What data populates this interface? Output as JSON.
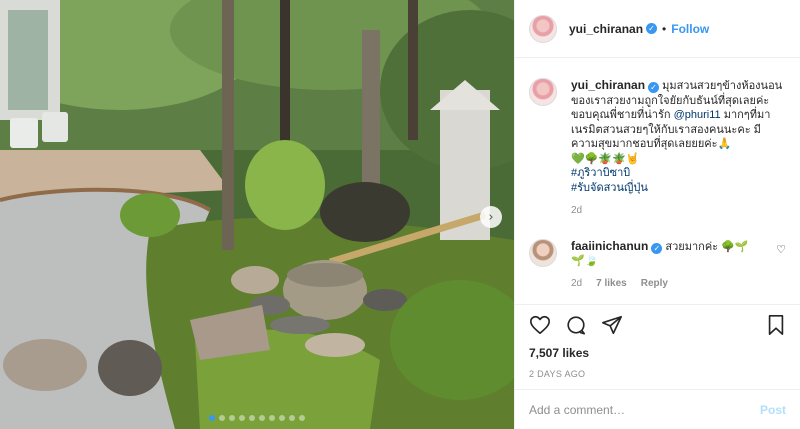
{
  "post": {
    "username": "yui_chiranan",
    "verified_mark": "✓",
    "separator": "•",
    "follow_label": "Follow",
    "carousel": {
      "dot_count": 10,
      "active_index": 0,
      "next_icon": "chevron-right-icon"
    }
  },
  "caption": {
    "username": "yui_chiranan",
    "text_before_mention": "มุมสวนสวยๆข้างห้องนอนของเราสวยงามถูกใจยัยกับธันน์ที่สุดเลยค่ะ ขอบคุณพี่ชายที่น่ารัก ",
    "mention": "@phuri11",
    "text_after_mention": " มากๆที่มาเนรมิตสวนสวยๆให้กับเราสองคนนะคะ มีความสุขมากชอบที่สุดเลยยยค่ะ🙏",
    "emoji_line": "💚🌳🪴🪴🤘",
    "hashtags": [
      "#ภูริวาบิซาบิ",
      "#รับจัดสวนญี่ปุ่น"
    ],
    "age": "2d"
  },
  "comment": {
    "username": "faaiinichanun",
    "text": " สวยมากค่ะ 🌳🌱",
    "text_line2": "🌱🍃",
    "age": "2d",
    "likes": "7 likes",
    "reply_label": "Reply"
  },
  "actions": {
    "likes_count": "7,507 likes",
    "date": "2 DAYS AGO"
  },
  "add_comment": {
    "placeholder": "Add a comment…",
    "post_label": "Post"
  }
}
